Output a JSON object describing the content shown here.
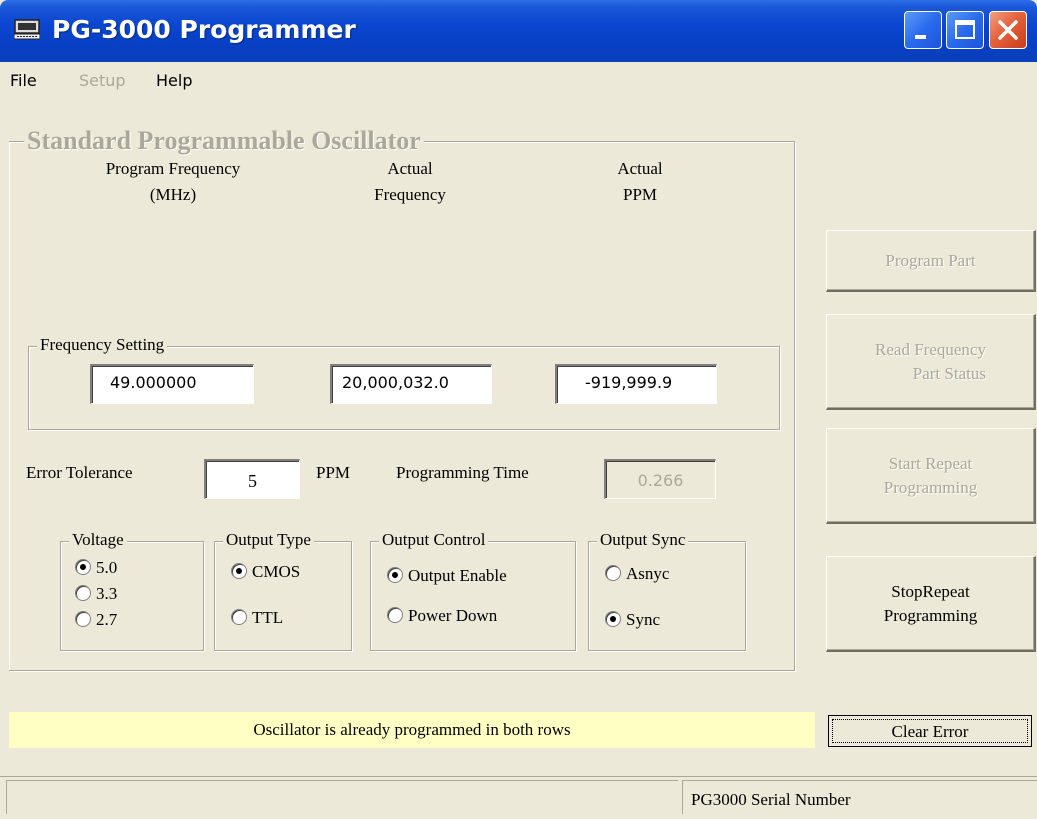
{
  "window": {
    "title": "PG-3000 Programmer"
  },
  "menu": {
    "items": [
      "File",
      "Setup",
      "Help"
    ]
  },
  "main_group": {
    "legend": "Standard Programmable Oscillator",
    "col_program_frequency": [
      "Program Frequency",
      "(MHz)"
    ],
    "col_actual_frequency": [
      "Actual",
      "Frequency"
    ],
    "col_actual_ppm": [
      "Actual",
      "PPM"
    ]
  },
  "frequency_setting": {
    "legend": "Frequency Setting",
    "program_frequency": "49.000000",
    "actual_frequency": "20,000,032.0",
    "actual_ppm": "-919,999.9"
  },
  "error_tolerance": {
    "label": "Error Tolerance",
    "value": "5",
    "unit": "PPM"
  },
  "programming_time": {
    "label": "Programming Time",
    "value": "0.266"
  },
  "voltage": {
    "legend": "Voltage",
    "options": [
      "5.0",
      "3.3",
      "2.7"
    ],
    "selected": "5.0"
  },
  "output_type": {
    "legend": "Output Type",
    "options": [
      "CMOS",
      "TTL"
    ],
    "selected": "CMOS"
  },
  "output_control": {
    "legend": "Output Control",
    "options": [
      "Output Enable",
      "Power Down"
    ],
    "selected": "Output Enable"
  },
  "output_sync": {
    "legend": "Output Sync",
    "options": [
      "Asnyc",
      "Sync"
    ],
    "selected": "Sync"
  },
  "buttons": {
    "program_part": "Program Part",
    "read_frequency": [
      "Read Frequency",
      "Part Status"
    ],
    "start_repeat": [
      "Start Repeat",
      "Programming"
    ],
    "stop_repeat": [
      "StopRepeat",
      "Programming"
    ],
    "clear_error": "Clear Error"
  },
  "error_message": "Oscillator is already programmed in both rows",
  "status_bar": {
    "serial_label": "PG3000 Serial Number"
  },
  "colors": {
    "title_bar": "#0a46d0",
    "error_bar_bg": "#ffffc4",
    "disabled_text": "#aca899",
    "window_bg": "#ece9d8"
  }
}
